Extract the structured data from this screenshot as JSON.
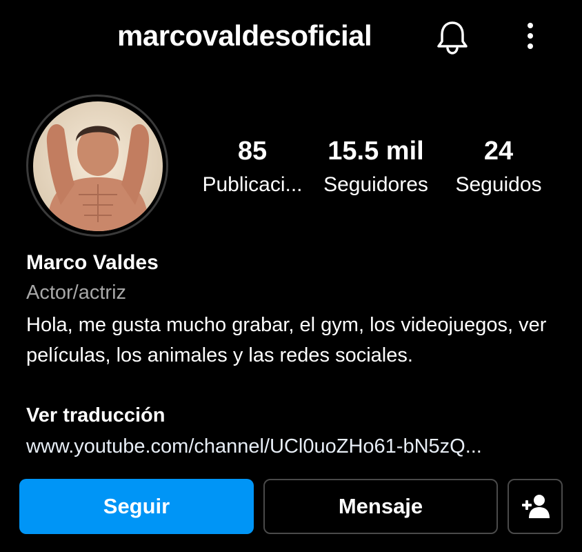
{
  "header": {
    "username": "marcovaldesoficial",
    "icons": [
      "bell-icon",
      "more-vertical-icon"
    ]
  },
  "profile": {
    "avatar": "profile-photo",
    "stats": [
      {
        "value": "85",
        "label": "Publicaci..."
      },
      {
        "value": "15.5 mil",
        "label": "Seguidores"
      },
      {
        "value": "24",
        "label": "Seguidos"
      }
    ],
    "name": "Marco Valdes",
    "category": "Actor/actriz",
    "bio": "Hola, me gusta mucho grabar, el gym, los videojuegos, ver películas, los animales y las redes sociales.",
    "translate_label": "Ver traducción",
    "link": "www.youtube.com/channel/UCl0uoZHo61-bN5zQ..."
  },
  "actions": {
    "follow_label": "Seguir",
    "message_label": "Mensaje",
    "suggest_icon": "add-person-icon"
  },
  "colors": {
    "background": "#000000",
    "primary_button": "#0095f6",
    "secondary_text": "#a8a8a8",
    "button_border": "#4a4a4a"
  }
}
